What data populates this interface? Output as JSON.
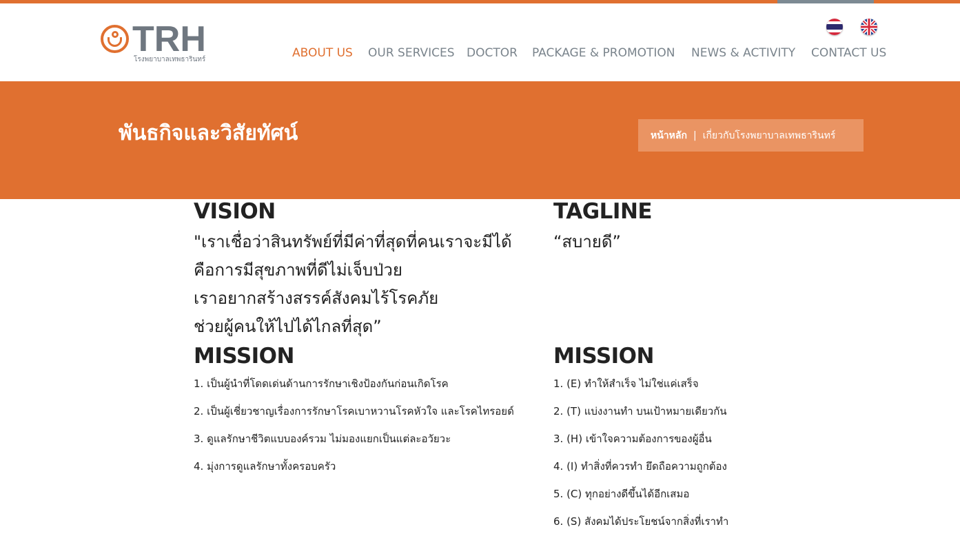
{
  "brand": {
    "logo_text": "TRH",
    "logo_subtitle": "โรงพยาบาลเทพธารินทร์",
    "accent_color": "#e07030",
    "gray_color": "#7a848c"
  },
  "language": {
    "thai_icon": "thai-flag-icon",
    "english_icon": "uk-flag-icon"
  },
  "nav": {
    "items": [
      {
        "label": "ABOUT US",
        "active": true
      },
      {
        "label": "OUR SERVICES",
        "active": false
      },
      {
        "label": "DOCTOR",
        "active": false
      },
      {
        "label": "PACKAGE & PROMOTION",
        "active": false
      },
      {
        "label": "NEWS & ACTIVITY",
        "active": false
      },
      {
        "label": "CONTACT US",
        "active": false
      }
    ]
  },
  "banner": {
    "title": "พันธกิจและวิสัยทัศน์",
    "breadcrumb": {
      "home": "หน้าหลัก",
      "separator": "|",
      "current": "เกี่ยวกับโรงพยาบาลเทพธารินทร์"
    }
  },
  "vision": {
    "heading": "VISION",
    "lines": [
      "\"เราเชื่อว่าสินทรัพย์ที่มีค่าที่สุดที่คนเราจะมีได้",
      "คือการมีสุขภาพที่ดีไม่เจ็บป่วย",
      "เราอยากสร้างสรรค์สังคมไร้โรคภัย",
      "ช่วยผู้คนให้ไปได้ไกลที่สุด”"
    ]
  },
  "tagline": {
    "heading": "TAGLINE",
    "text": "“สบายดี”"
  },
  "mission_left": {
    "heading": "MISSION",
    "items": [
      "1. เป็นผู้นำที่โดดเด่นด้านการรักษาเชิงป้องกันก่อนเกิดโรค",
      "2. เป็นผู้เชี่ยวชาญเรื่องการรักษาโรคเบาหวานโรคหัวใจ และโรคไทรอยด์",
      "3. ดูแลรักษาชีวิตแบบองค์รวม ไม่มองแยกเป็นแต่ละอวัยวะ",
      "4. มุ่งการดูแลรักษาทั้งครอบครัว"
    ]
  },
  "mission_right": {
    "heading": "MISSION",
    "items": [
      "1. (E) ทำให้สำเร็จ ไม่ใช่แค่เสร็จ",
      "2. (T) แบ่งงานทำ บนเป้าหมายเดียวกัน",
      "3. (H) เข้าใจความต้องการของผู้อื่น",
      "4. (I) ทำสิ่งที่ควรทำ ยึดถือความถูกต้อง",
      "5. (C) ทุกอย่างดีขึ้นได้อีกเสมอ",
      "6. (S) สังคมได้ประโยชน์จากสิ่งที่เราทำ"
    ]
  }
}
